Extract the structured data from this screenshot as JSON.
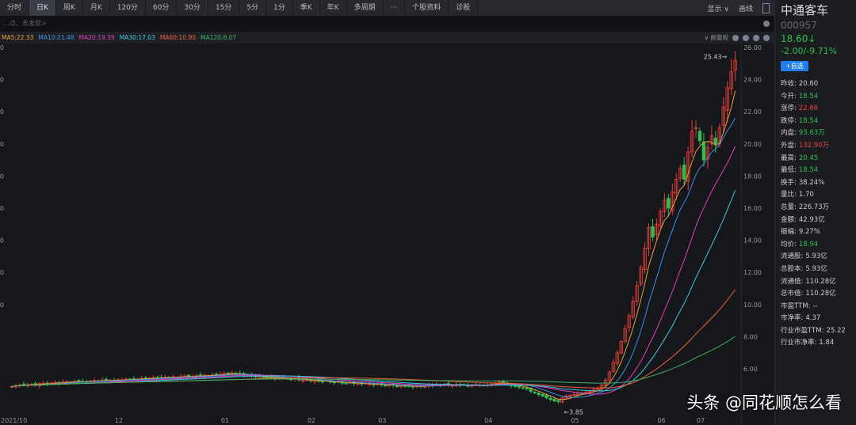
{
  "toolbar": {
    "tabs": [
      "分时",
      "日K",
      "周K",
      "月K",
      "120分",
      "60分",
      "30分",
      "15分",
      "5分",
      "1分",
      "季K",
      "年K",
      "多周期",
      "···",
      "个股资料",
      "诊股"
    ],
    "active": 1,
    "display": "显示 ∨",
    "draw": "画线"
  },
  "info": {
    "text": "…点、去发现>"
  },
  "ma_legend": [
    {
      "label": "MA5:22.33",
      "color": "#e8a03c"
    },
    {
      "label": "MA10:21.48",
      "color": "#3a8ee6"
    },
    {
      "label": "MA20:19.39",
      "color": "#e040c0"
    },
    {
      "label": "MA30:17.03",
      "color": "#3ec8e0"
    },
    {
      "label": "MA60:10.90",
      "color": "#f0603c"
    },
    {
      "label": "MA120:8.07",
      "color": "#3cb060"
    }
  ],
  "adjust": "∨ 前复权",
  "stock": {
    "name": "中通客车",
    "code": "000957",
    "price": "18.60↓",
    "change": "-2.00/-9.71%",
    "add_button": "+自选"
  },
  "stats": [
    {
      "k": "昨收:",
      "v": "20.60",
      "c": "#ccc"
    },
    {
      "k": "今开:",
      "v": "18.54",
      "c": "#2fbf4f"
    },
    {
      "k": "涨停:",
      "v": "22.66",
      "c": "#e8413c"
    },
    {
      "k": "跌停:",
      "v": "18.54",
      "c": "#2fbf4f"
    },
    {
      "k": "内盘:",
      "v": "93.63万",
      "c": "#2fbf4f"
    },
    {
      "k": "外盘:",
      "v": "132.90万",
      "c": "#e8413c"
    },
    {
      "k": "最高:",
      "v": "20.45",
      "c": "#2fbf4f"
    },
    {
      "k": "最低:",
      "v": "18.54",
      "c": "#2fbf4f"
    },
    {
      "k": "换手:",
      "v": "38.24%",
      "c": "#ccc"
    },
    {
      "k": "量比:",
      "v": "1.70",
      "c": "#ccc"
    },
    {
      "k": "总量:",
      "v": "226.73万",
      "c": "#ccc"
    },
    {
      "k": "金额:",
      "v": "42.93亿",
      "c": "#ccc"
    },
    {
      "k": "振幅:",
      "v": "9.27%",
      "c": "#ccc"
    },
    {
      "k": "均价:",
      "v": "18.94",
      "c": "#2fbf4f"
    },
    {
      "k": "流通股:",
      "v": "5.93亿",
      "c": "#ccc"
    },
    {
      "k": "总股本:",
      "v": "5.93亿",
      "c": "#ccc"
    },
    {
      "k": "流通值:",
      "v": "110.28亿",
      "c": "#ccc"
    },
    {
      "k": "总市值:",
      "v": "110.28亿",
      "c": "#ccc"
    },
    {
      "k": "市盈TTM:",
      "v": "--",
      "c": "#ccc"
    },
    {
      "k": "市净率:",
      "v": "4.37",
      "c": "#ccc"
    },
    {
      "k": "行业市盈TTM:",
      "v": "25.22",
      "c": "#ccc"
    },
    {
      "k": "行业市净率:",
      "v": "1.84",
      "c": "#ccc"
    }
  ],
  "chart_data": {
    "type": "candlestick",
    "y_ticks": [
      "26.00",
      "24.00",
      "22.00",
      "20.00",
      "18.00",
      "16.00",
      "14.00",
      "12.00",
      "10.00",
      "8.00",
      "6.00"
    ],
    "ylim": [
      3.5,
      26.5
    ],
    "x_labels": [
      {
        "label": "2021/10",
        "index": 0
      },
      {
        "label": "12",
        "index": 27
      },
      {
        "label": "01",
        "index": 54
      },
      {
        "label": "02",
        "index": 76
      },
      {
        "label": "03",
        "index": 94
      },
      {
        "label": "04",
        "index": 121
      },
      {
        "label": "05",
        "index": 143
      },
      {
        "label": "06",
        "index": 165
      },
      {
        "label": "07",
        "index": 175
      }
    ],
    "high_label": "25.43→",
    "low_label": "←3.85",
    "high_value": 25.43,
    "low_value": 3.85,
    "low_index": 140,
    "closes": [
      4.9,
      4.95,
      5.0,
      4.98,
      5.02,
      5.05,
      5.0,
      5.08,
      5.1,
      5.05,
      5.12,
      5.15,
      5.1,
      5.18,
      5.2,
      5.15,
      5.22,
      5.25,
      5.2,
      5.18,
      5.24,
      5.28,
      5.22,
      5.3,
      5.26,
      5.3,
      5.28,
      5.32,
      5.3,
      5.35,
      5.33,
      5.38,
      5.36,
      5.4,
      5.35,
      5.42,
      5.45,
      5.4,
      5.44,
      5.48,
      5.45,
      5.5,
      5.46,
      5.52,
      5.55,
      5.5,
      5.53,
      5.58,
      5.55,
      5.6,
      5.57,
      5.62,
      5.6,
      5.65,
      5.7,
      5.68,
      5.75,
      5.7,
      5.65,
      5.6,
      5.62,
      5.55,
      5.5,
      5.52,
      5.48,
      5.45,
      5.5,
      5.42,
      5.4,
      5.45,
      5.38,
      5.35,
      5.4,
      5.3,
      5.28,
      5.32,
      5.25,
      5.3,
      5.22,
      5.2,
      5.26,
      5.18,
      5.15,
      5.2,
      5.12,
      5.1,
      5.15,
      5.08,
      5.12,
      5.05,
      5.1,
      5.06,
      5.02,
      5.05,
      5.0,
      4.95,
      5.02,
      4.98,
      4.92,
      4.96,
      4.9,
      4.94,
      4.88,
      4.92,
      4.9,
      4.95,
      5.0,
      4.96,
      5.02,
      4.98,
      5.05,
      5.0,
      4.97,
      5.02,
      4.98,
      5.0,
      4.95,
      4.98,
      5.02,
      5.0,
      4.96,
      5.0,
      5.05,
      5.1,
      5.2,
      5.15,
      5.05,
      4.95,
      4.9,
      4.85,
      4.8,
      4.75,
      4.6,
      4.5,
      4.4,
      4.3,
      4.2,
      4.1,
      4.0,
      3.95,
      4.2,
      4.3,
      4.35,
      4.4,
      4.5,
      4.45,
      4.55,
      4.6,
      4.7,
      4.8,
      5.0,
      5.3,
      5.8,
      6.4,
      7.0,
      7.7,
      8.5,
      9.3,
      10.2,
      11.2,
      12.3,
      13.5,
      14.8,
      14.2,
      15.0,
      15.8,
      16.5,
      16.0,
      17.0,
      17.8,
      18.5,
      17.8,
      19.5,
      20.8,
      21.0,
      20.2,
      19.0,
      19.8,
      20.5,
      20.0,
      21.0,
      22.3,
      23.5,
      24.5,
      25.2
    ],
    "ma_periods": [
      5,
      10,
      20,
      30,
      60,
      120
    ],
    "up_color": "#e8413c",
    "down_color": "#2fbf4f"
  },
  "watermark": "头条 @同花顺怎么看"
}
